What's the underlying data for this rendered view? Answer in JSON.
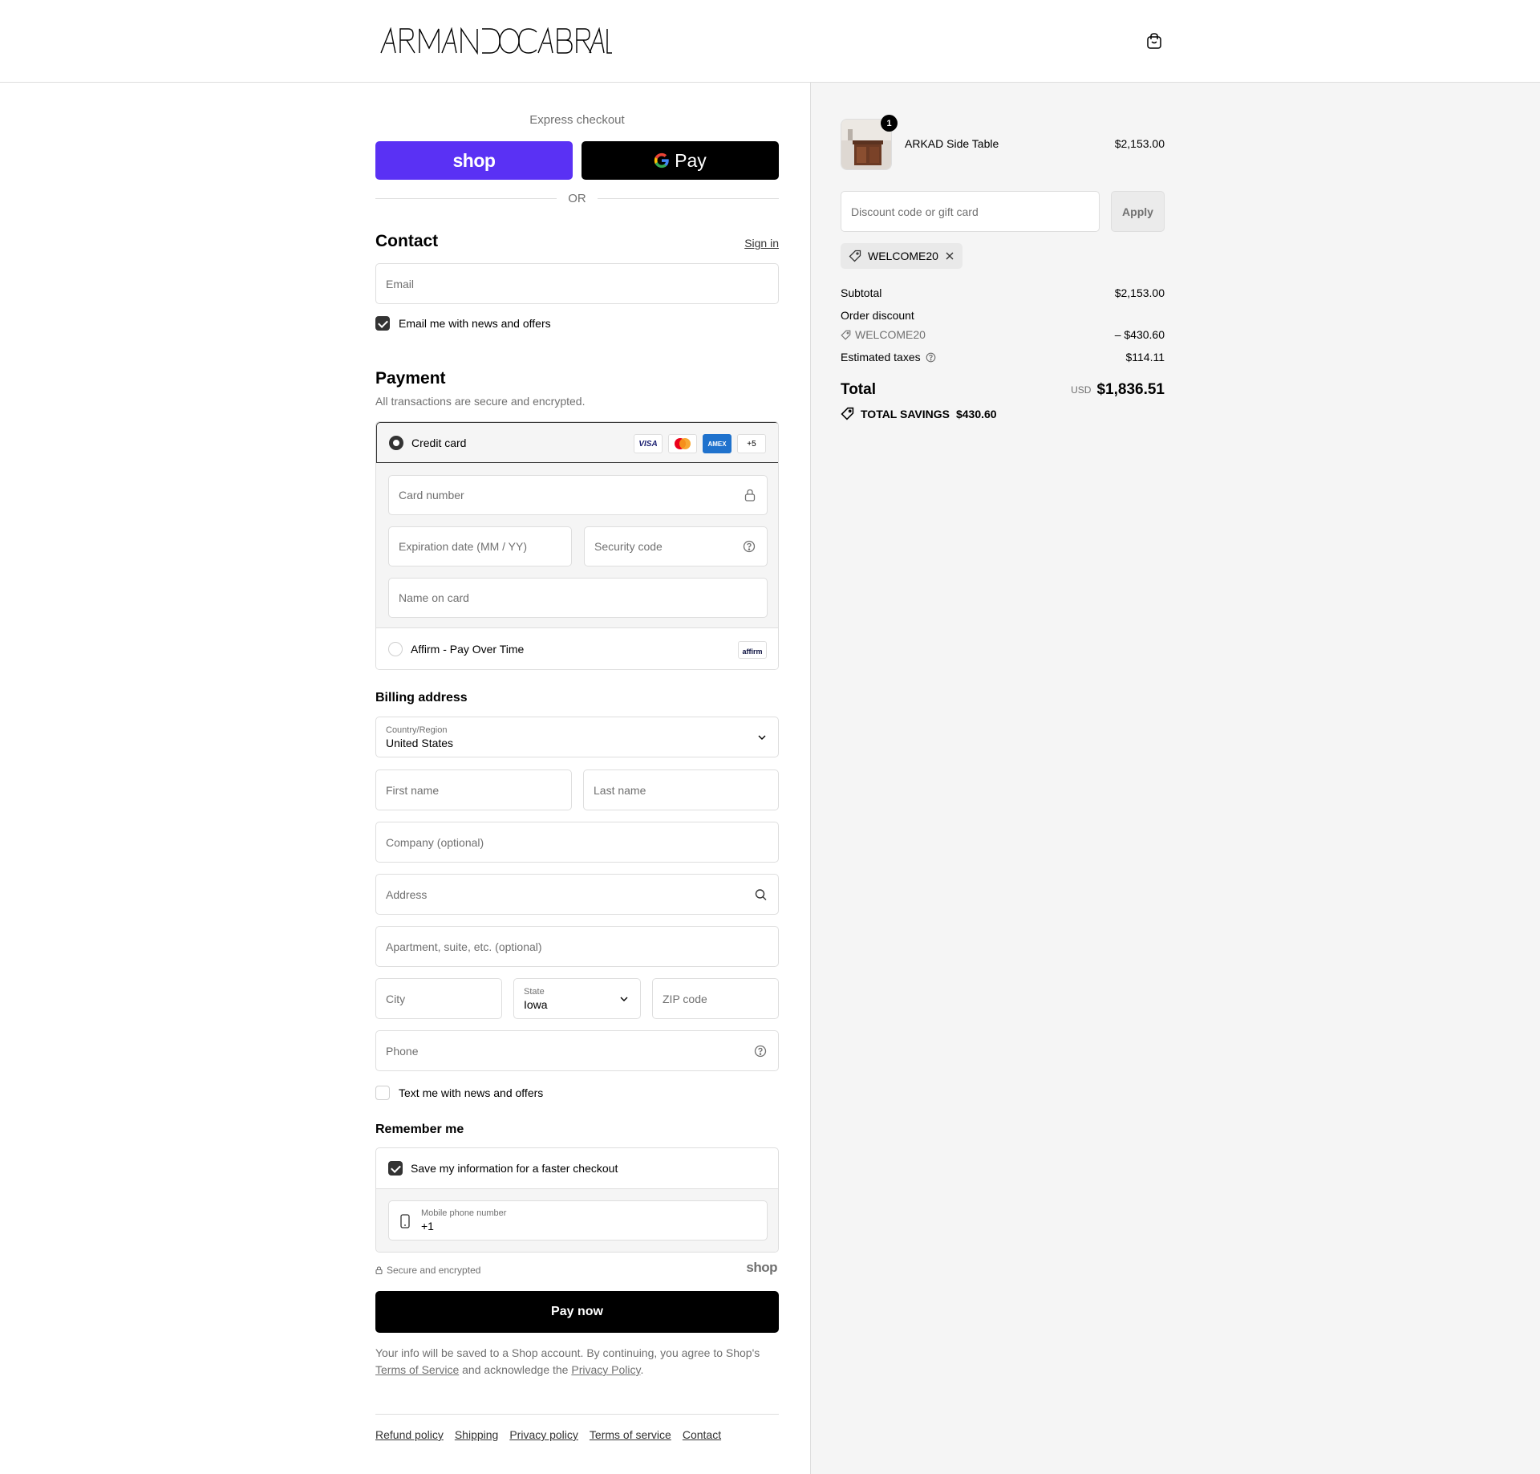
{
  "header": {
    "logo_text": "ARMANDOCABRAL"
  },
  "express": {
    "title": "Express checkout",
    "shop_label": "shop",
    "gpay_label": "Pay",
    "or_label": "OR"
  },
  "contact": {
    "title": "Contact",
    "sign_in": "Sign in",
    "email_placeholder": "Email",
    "newsletter_label": "Email me with news and offers"
  },
  "payment": {
    "title": "Payment",
    "subtitle": "All transactions are secure and encrypted.",
    "credit_card_label": "Credit card",
    "card_logos": [
      "VISA",
      "MC",
      "AMEX",
      "+5"
    ],
    "card_number_placeholder": "Card number",
    "expiration_placeholder": "Expiration date (MM / YY)",
    "security_placeholder": "Security code",
    "name_placeholder": "Name on card",
    "affirm_label": "Affirm - Pay Over Time",
    "affirm_logo": "affirm"
  },
  "billing": {
    "title": "Billing address",
    "country_label": "Country/Region",
    "country_value": "United States",
    "first_name": "First name",
    "last_name": "Last name",
    "company": "Company (optional)",
    "address": "Address",
    "apartment": "Apartment, suite, etc. (optional)",
    "city": "City",
    "state_label": "State",
    "state_value": "Iowa",
    "zip": "ZIP code",
    "phone": "Phone",
    "text_label": "Text me with news and offers"
  },
  "remember": {
    "title": "Remember me",
    "save_label": "Save my information for a faster checkout",
    "mobile_label": "Mobile phone number",
    "mobile_value": "+1",
    "secure_label": "Secure and encrypted",
    "shop_logo": "shop"
  },
  "pay_button": "Pay now",
  "legal": {
    "text_1": "Your info will be saved to a Shop account. By continuing, you agree to Shop's",
    "terms": "Terms of Service",
    "text_2": "and acknowledge the",
    "privacy": "Privacy Policy",
    "text_3": "."
  },
  "footer": {
    "links": [
      "Refund policy",
      "Shipping",
      "Privacy policy",
      "Terms of service",
      "Contact"
    ]
  },
  "summary": {
    "product_name": "ARKAD Side Table",
    "product_price": "$2,153.00",
    "quantity": "1",
    "discount_placeholder": "Discount code or gift card",
    "apply_label": "Apply",
    "applied_code": "WELCOME20",
    "subtotal_label": "Subtotal",
    "subtotal_value": "$2,153.00",
    "order_discount_label": "Order discount",
    "discount_code": "WELCOME20",
    "discount_value": "– $430.60",
    "taxes_label": "Estimated taxes",
    "taxes_value": "$114.11",
    "total_label": "Total",
    "currency": "USD",
    "total_value": "$1,836.51",
    "savings_label": "TOTAL SAVINGS",
    "savings_value": "$430.60"
  },
  "colors": {
    "shop_purple": "#5a31f4",
    "text_muted": "#707070",
    "border": "#dedede",
    "summary_bg": "#f5f5f5"
  }
}
